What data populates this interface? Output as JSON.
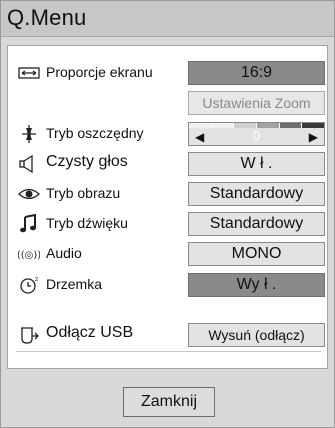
{
  "title": "Q.Menu",
  "items": [
    {
      "label": "Proporcje ekranu",
      "value": "16:9",
      "icon": "aspect-ratio-icon"
    },
    {
      "label": "",
      "value": "Ustawienia Zoom"
    },
    {
      "label": "Tryb oszczędny",
      "value": "0",
      "icon": "energy-saving-icon"
    },
    {
      "label": "Czysty głos",
      "value": "W ł .",
      "icon": "clear-voice-icon"
    },
    {
      "label": "Tryb obrazu",
      "value": "Standardowy",
      "icon": "eye-icon"
    },
    {
      "label": "Tryb dźwięku",
      "value": "Standardowy",
      "icon": "music-note-icon"
    },
    {
      "label": "Audio",
      "value": "MONO",
      "icon": "audio-icon"
    },
    {
      "label": "Drzemka",
      "value": "Wy ł .",
      "icon": "sleep-timer-icon"
    },
    {
      "label": "Odłącz USB",
      "value": "Wysuń (odłącz)",
      "icon": "usb-eject-icon"
    }
  ],
  "close_label": "Zamknij",
  "energy_slider_level": 0
}
